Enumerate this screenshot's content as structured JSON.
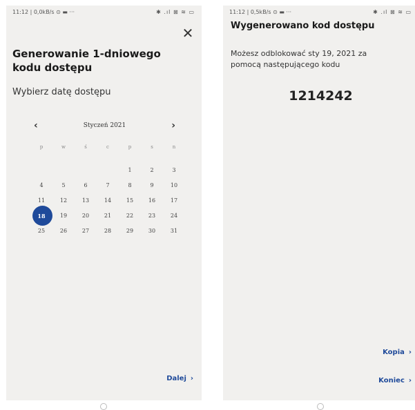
{
  "left": {
    "status_left": "11:12 | 0,0kB/s ⊙ ▬ ···",
    "status_right": "✱ .ıl ⊠ ≋ ▭",
    "close_icon": "close-icon",
    "title": "Generowanie 1-dniowego kodu dostępu",
    "subtitle": "Wybierz datę dostępu",
    "calendar": {
      "month": "Styczeń 2021",
      "prev": "‹",
      "next": "›",
      "weekdays": [
        "p",
        "w",
        "ś",
        "c",
        "p",
        "s",
        "n"
      ],
      "rows": [
        [
          "",
          "",
          "",
          "",
          "1",
          "2",
          "3"
        ],
        [
          "4",
          "5",
          "6",
          "7",
          "8",
          "9",
          "10"
        ],
        [
          "11",
          "12",
          "13",
          "14",
          "15",
          "16",
          "17"
        ],
        [
          "18",
          "19",
          "20",
          "21",
          "22",
          "23",
          "24"
        ],
        [
          "25",
          "26",
          "27",
          "28",
          "29",
          "30",
          "31"
        ]
      ],
      "selected": "18"
    },
    "next_label": "Dalej",
    "next_arrow": "›"
  },
  "right": {
    "status_left": "11:12 | 0,5kB/s ⊙ ▬ ···",
    "status_right": "✱ .ıl ⊠ ≋ ▭",
    "title": "Wygenerowano kod dostępu",
    "body": "Możesz odblokować sty 19, 2021 za pomocą następującego kodu",
    "code": "1214242",
    "copy_label": "Kopia",
    "end_label": "Koniec",
    "arrow": "›"
  },
  "colors": {
    "accent": "#1f4a9a",
    "background": "#f1f0ee"
  }
}
